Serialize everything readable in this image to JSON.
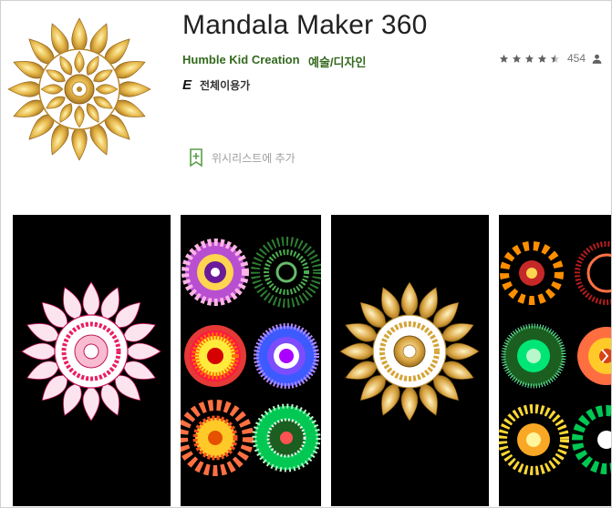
{
  "app": {
    "title": "Mandala Maker 360",
    "developer": "Humble Kid Creation",
    "category": "예술/디자인",
    "rating_count": "454",
    "rating_value": 4.5,
    "content_rating_badge": "E",
    "content_rating_label": "전체이용가",
    "wishlist_label": "위시리스트에 추가"
  },
  "icons": {
    "wishlist": "bookmark-add-icon",
    "user": "person-icon",
    "star": "star-icon",
    "next": "chevron-right-icon"
  },
  "colors": {
    "developer": "#33691e",
    "screenshot_bg": "#000000",
    "star": "#616161",
    "gold": "#d4a437"
  }
}
